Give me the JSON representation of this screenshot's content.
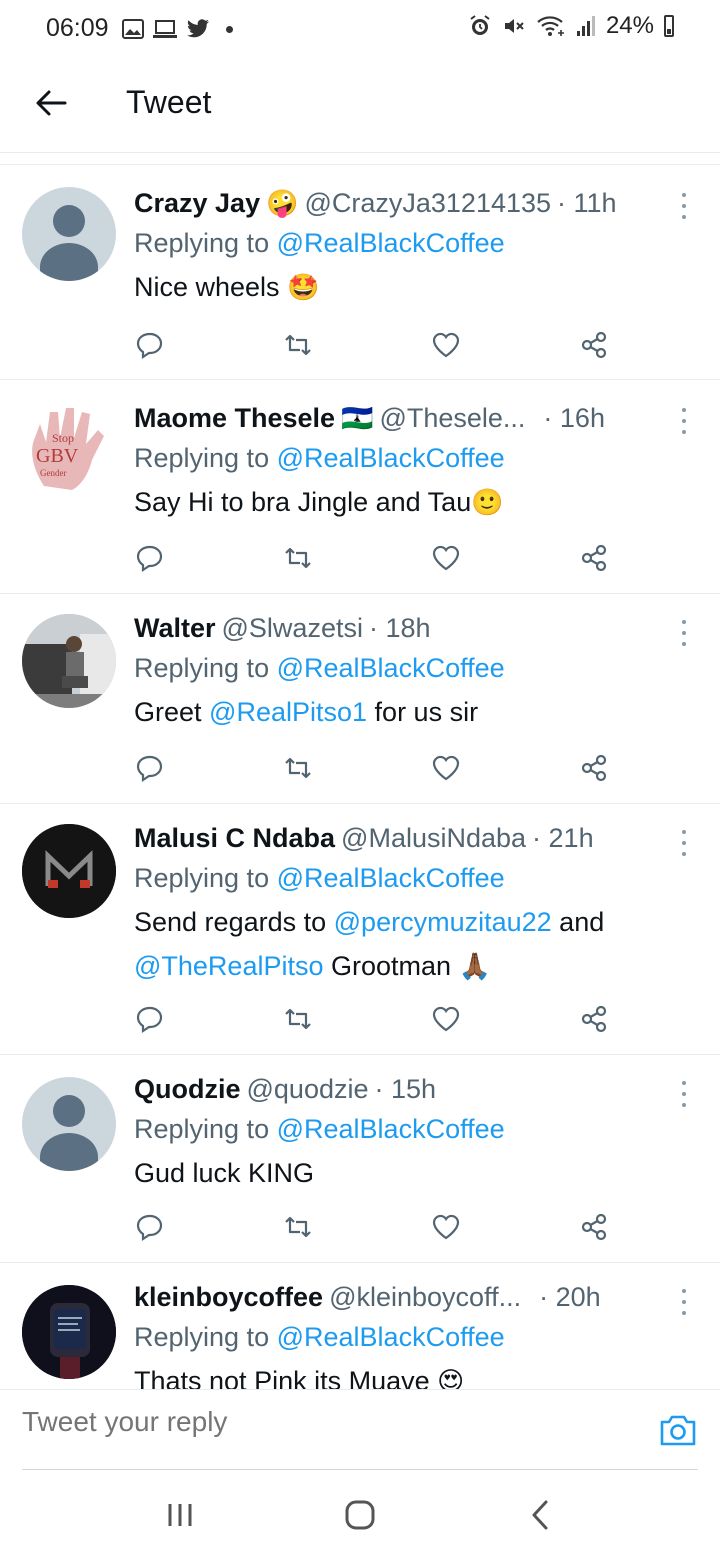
{
  "status_bar": {
    "time": "06:09",
    "battery": "24%",
    "left_icons": [
      "gallery-icon",
      "laptop-icon",
      "twitter-bird-icon",
      "dot"
    ],
    "right_icons": [
      "alarm-icon",
      "mute-icon",
      "wifi-icon",
      "signal-icon",
      "battery-icon"
    ]
  },
  "header": {
    "title": "Tweet"
  },
  "tweets": [
    {
      "name": "Crazy Jay",
      "name_emoji": "🤪",
      "handle": "@CrazyJa31214135",
      "time": "· 11h",
      "replying_prefix": "Replying to",
      "replying_to": "@RealBlackCoffee",
      "text": "Nice wheels",
      "text_emoji": "🤩"
    },
    {
      "name": "Maome Thesele",
      "name_emoji": "🇱🇸",
      "handle": "@Thesele...",
      "time": "· 16h",
      "replying_prefix": "Replying to",
      "replying_to": "@RealBlackCoffee",
      "text": "Say Hi to bra Jingle and Tau",
      "text_emoji": "🙂",
      "avatar_text": [
        "Stop",
        "GBV",
        "Gender"
      ]
    },
    {
      "name": "Walter",
      "handle": "@Slwazetsi",
      "time": "· 18h",
      "replying_prefix": "Replying to",
      "replying_to": "@RealBlackCoffee",
      "text_before": "Greet",
      "text_mention": "@RealPitso1",
      "text_after": "for us sir"
    },
    {
      "name": "Malusi C Ndaba",
      "handle": "@MalusiNdaba",
      "time": "· 21h",
      "replying_prefix": "Replying to",
      "replying_to": "@RealBlackCoffee",
      "text_1": "Send regards to",
      "text_mention_1": "@percymuzitau22",
      "text_2": "and",
      "text_mention_2": "@TheRealPitso",
      "text_3": "Grootman",
      "text_emoji": "🙏🏾"
    },
    {
      "name": "Quodzie",
      "handle": "@quodzie",
      "time": "· 15h",
      "replying_prefix": "Replying to",
      "replying_to": "@RealBlackCoffee",
      "text": "Gud luck KING"
    },
    {
      "name": "kleinboycoffee",
      "handle": "@kleinboycoff...",
      "time": "· 20h",
      "replying_prefix": "Replying to",
      "replying_to": "@RealBlackCoffee",
      "text": "Thats not Pink its Muave",
      "text_emoji": "😍"
    }
  ],
  "reply_bar": {
    "placeholder": "Tweet your reply"
  },
  "colors": {
    "accent": "#1d9bf0",
    "secondary_text": "#536471",
    "primary_text": "#0f1419",
    "divider": "#e6ecf0"
  }
}
